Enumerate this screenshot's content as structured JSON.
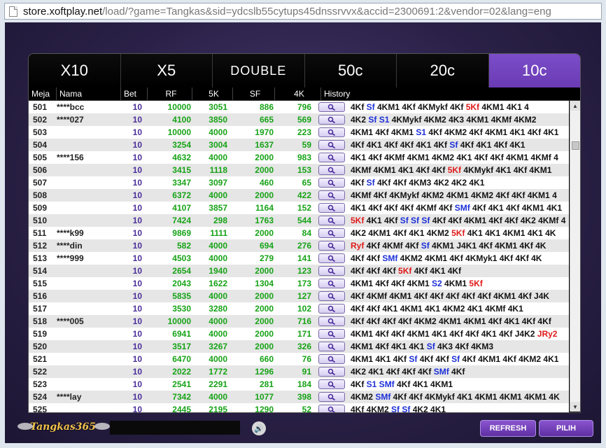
{
  "browser": {
    "url_host": "store.xoftplay.net",
    "url_path": "/load/?game=Tangkas&sid=ydcslb55cytups45dnssrvvx&accid=2300691:2&vendor=02&lang=eng"
  },
  "tabs": [
    {
      "label": "X10",
      "active": false
    },
    {
      "label": "X5",
      "active": false
    },
    {
      "label": "DOUBLE",
      "active": false
    },
    {
      "label": "50c",
      "active": false
    },
    {
      "label": "20c",
      "active": false
    },
    {
      "label": "10c",
      "active": true
    }
  ],
  "columns": [
    "Meja",
    "Nama",
    "Bet",
    "RF",
    "5K",
    "SF",
    "4K",
    "History"
  ],
  "rows": [
    {
      "meja": "501",
      "nama": "****bcc",
      "bet": "10",
      "rf": "10000",
      "k5": "3051",
      "sf": "886",
      "k4": "796",
      "history": [
        [
          "4Kf ",
          ""
        ],
        [
          "Sf",
          "b"
        ],
        [
          " 4KM1 4Kf 4KMykf 4Kf ",
          ""
        ],
        [
          "5Kf",
          "r"
        ],
        [
          " 4KM1 4K1 4",
          ""
        ]
      ]
    },
    {
      "meja": "502",
      "nama": "****027",
      "bet": "10",
      "rf": "4100",
      "k5": "3850",
      "sf": "665",
      "k4": "569",
      "history": [
        [
          "4K2 ",
          ""
        ],
        [
          "Sf S1",
          "b"
        ],
        [
          " 4KMykf 4KM2 4K3 4KM1 4KMf 4KM2",
          ""
        ]
      ]
    },
    {
      "meja": "503",
      "nama": "",
      "bet": "10",
      "rf": "10000",
      "k5": "4000",
      "sf": "1970",
      "k4": "223",
      "history": [
        [
          "4KM1 4Kf 4KM1 ",
          ""
        ],
        [
          "S1",
          "b"
        ],
        [
          " 4Kf 4KM2 4Kf 4KM1 4K1 4Kf 4K1",
          ""
        ]
      ]
    },
    {
      "meja": "504",
      "nama": "",
      "bet": "10",
      "rf": "3254",
      "k5": "3004",
      "sf": "1637",
      "k4": "59",
      "history": [
        [
          "4Kf 4K1 4Kf 4Kf 4K1 4Kf ",
          ""
        ],
        [
          "Sf",
          "b"
        ],
        [
          " 4Kf 4K1 4Kf 4K1",
          ""
        ]
      ]
    },
    {
      "meja": "505",
      "nama": "****156",
      "bet": "10",
      "rf": "4632",
      "k5": "4000",
      "sf": "2000",
      "k4": "983",
      "history": [
        [
          "4K1 4Kf 4KMf 4KM1 4KM2 4K1 4Kf 4Kf 4KM1 4KMf 4",
          ""
        ]
      ]
    },
    {
      "meja": "506",
      "nama": "",
      "bet": "10",
      "rf": "3415",
      "k5": "1118",
      "sf": "2000",
      "k4": "153",
      "history": [
        [
          "4KMf 4KM1 4K1 4Kf 4Kf ",
          ""
        ],
        [
          "5Kf",
          "r"
        ],
        [
          " 4KMykf 4K1 4Kf 4KM1",
          ""
        ]
      ]
    },
    {
      "meja": "507",
      "nama": "",
      "bet": "10",
      "rf": "3347",
      "k5": "3097",
      "sf": "460",
      "k4": "65",
      "history": [
        [
          "4Kf ",
          ""
        ],
        [
          "Sf",
          "b"
        ],
        [
          " 4Kf 4Kf 4KM3 4K2 4K2 4K1",
          ""
        ]
      ]
    },
    {
      "meja": "508",
      "nama": "",
      "bet": "10",
      "rf": "6372",
      "k5": "4000",
      "sf": "2000",
      "k4": "422",
      "history": [
        [
          "4KMf 4Kf 4KMykf 4KM2 4KM1 4KM2 4Kf 4Kf 4KM1 4",
          ""
        ]
      ]
    },
    {
      "meja": "509",
      "nama": "",
      "bet": "10",
      "rf": "4107",
      "k5": "3857",
      "sf": "1164",
      "k4": "152",
      "history": [
        [
          "4K1 4Kf 4Kf 4Kf 4KMf 4Kf ",
          ""
        ],
        [
          "SMf",
          "b"
        ],
        [
          " 4Kf 4K1 4Kf 4KM1 4K1",
          ""
        ]
      ]
    },
    {
      "meja": "510",
      "nama": "",
      "bet": "10",
      "rf": "7424",
      "k5": "298",
      "sf": "1763",
      "k4": "544",
      "history": [
        [
          "5Kf",
          "r"
        ],
        [
          " 4K1 4Kf ",
          ""
        ],
        [
          "Sf Sf Sf",
          "b"
        ],
        [
          " 4Kf 4Kf 4KM1 4Kf 4Kf 4K2 4KMf 4",
          ""
        ]
      ]
    },
    {
      "meja": "511",
      "nama": "****k99",
      "bet": "10",
      "rf": "9869",
      "k5": "1111",
      "sf": "2000",
      "k4": "84",
      "history": [
        [
          "4K2 4KM1 4Kf 4K1 4KM2 ",
          ""
        ],
        [
          "5Kf",
          "r"
        ],
        [
          " 4K1 4K1 4KM1 4K1 4K",
          ""
        ]
      ]
    },
    {
      "meja": "512",
      "nama": "****din",
      "bet": "10",
      "rf": "582",
      "k5": "4000",
      "sf": "694",
      "k4": "276",
      "history": [
        [
          "Ryf",
          "r"
        ],
        [
          " 4Kf 4KMf 4Kf ",
          ""
        ],
        [
          "Sf",
          "b"
        ],
        [
          " 4KM1 J4K1 4Kf 4KM1 4Kf 4K",
          ""
        ]
      ]
    },
    {
      "meja": "513",
      "nama": "****999",
      "bet": "10",
      "rf": "4503",
      "k5": "4000",
      "sf": "279",
      "k4": "141",
      "history": [
        [
          "4Kf 4Kf ",
          ""
        ],
        [
          "SMf",
          "b"
        ],
        [
          " 4KM2 4KM1 4Kf 4KMyk1 4Kf 4Kf 4K",
          ""
        ]
      ]
    },
    {
      "meja": "514",
      "nama": "",
      "bet": "10",
      "rf": "2654",
      "k5": "1940",
      "sf": "2000",
      "k4": "123",
      "history": [
        [
          "4Kf 4Kf 4Kf ",
          ""
        ],
        [
          "5Kf",
          "r"
        ],
        [
          " 4Kf 4K1 4Kf",
          ""
        ]
      ]
    },
    {
      "meja": "515",
      "nama": "",
      "bet": "10",
      "rf": "2043",
      "k5": "1622",
      "sf": "1304",
      "k4": "173",
      "history": [
        [
          "4KM1 4Kf 4Kf 4KM1 ",
          ""
        ],
        [
          "S2",
          "b"
        ],
        [
          " 4KM1 ",
          ""
        ],
        [
          "5Kf",
          "r"
        ]
      ]
    },
    {
      "meja": "516",
      "nama": "",
      "bet": "10",
      "rf": "5835",
      "k5": "4000",
      "sf": "2000",
      "k4": "127",
      "history": [
        [
          "4Kf 4KMf 4KM1 4Kf 4Kf 4Kf 4Kf 4Kf 4KM1 4Kf J4K",
          ""
        ]
      ]
    },
    {
      "meja": "517",
      "nama": "",
      "bet": "10",
      "rf": "3530",
      "k5": "3280",
      "sf": "2000",
      "k4": "102",
      "history": [
        [
          "4Kf 4Kf 4K1 4KM1 4K1 4KM2 4K1 4KMf 4K1",
          ""
        ]
      ]
    },
    {
      "meja": "518",
      "nama": "****005",
      "bet": "10",
      "rf": "10000",
      "k5": "4000",
      "sf": "2000",
      "k4": "716",
      "history": [
        [
          "4Kf 4Kf 4Kf 4Kf 4KM2 4KM1 4KM1 4Kf 4K1 4Kf 4Kf",
          ""
        ]
      ]
    },
    {
      "meja": "519",
      "nama": "",
      "bet": "10",
      "rf": "6941",
      "k5": "4000",
      "sf": "2000",
      "k4": "171",
      "history": [
        [
          "4KM1 4Kf 4Kf 4KM1 4K1 4Kf 4Kf 4K1 4Kf J4K2 ",
          ""
        ],
        [
          "JRy2",
          "r"
        ]
      ]
    },
    {
      "meja": "520",
      "nama": "",
      "bet": "10",
      "rf": "3517",
      "k5": "3267",
      "sf": "2000",
      "k4": "326",
      "history": [
        [
          "4KM1 4Kf 4K1 4K1 ",
          ""
        ],
        [
          "Sf",
          "b"
        ],
        [
          " 4K3 4Kf 4KM3",
          ""
        ]
      ]
    },
    {
      "meja": "521",
      "nama": "",
      "bet": "10",
      "rf": "6470",
      "k5": "4000",
      "sf": "660",
      "k4": "76",
      "history": [
        [
          "4KM1 4K1 4Kf ",
          ""
        ],
        [
          "Sf",
          "b"
        ],
        [
          " 4Kf 4Kf ",
          ""
        ],
        [
          "Sf",
          "b"
        ],
        [
          " 4Kf 4KM1 4Kf 4KM2 4K1",
          ""
        ]
      ]
    },
    {
      "meja": "522",
      "nama": "",
      "bet": "10",
      "rf": "2022",
      "k5": "1772",
      "sf": "1296",
      "k4": "91",
      "history": [
        [
          "4K2 4K1 4Kf 4Kf 4Kf ",
          ""
        ],
        [
          "SMf",
          "b"
        ],
        [
          " 4Kf",
          ""
        ]
      ]
    },
    {
      "meja": "523",
      "nama": "",
      "bet": "10",
      "rf": "2541",
      "k5": "2291",
      "sf": "281",
      "k4": "184",
      "history": [
        [
          "4Kf ",
          ""
        ],
        [
          "S1 SMf",
          "b"
        ],
        [
          " 4Kf 4K1 4KM1",
          ""
        ]
      ]
    },
    {
      "meja": "524",
      "nama": "****lay",
      "bet": "10",
      "rf": "7342",
      "k5": "4000",
      "sf": "1077",
      "k4": "398",
      "history": [
        [
          "4KM2 ",
          ""
        ],
        [
          "SMf",
          "b"
        ],
        [
          " 4Kf 4Kf 4KMykf 4K1 4KM1 4KM1 4KM1 4K",
          ""
        ]
      ]
    },
    {
      "meja": "525",
      "nama": "",
      "bet": "10",
      "rf": "2445",
      "k5": "2195",
      "sf": "1290",
      "k4": "52",
      "history": [
        [
          "4Kf 4KM2 ",
          ""
        ],
        [
          "Sf Sf",
          "b"
        ],
        [
          " 4K2 4K1",
          ""
        ]
      ]
    }
  ],
  "footer": {
    "logo_text": "Tangkas365",
    "refresh_label": "REFRESH",
    "pilih_label": "PILIH"
  },
  "colors": {
    "active_tab": "#6a3bb3",
    "value_green": "#17a317",
    "bet_purple": "#4b2f9b",
    "history_blue": "#1c2fd8",
    "history_red": "#e01a1a"
  }
}
